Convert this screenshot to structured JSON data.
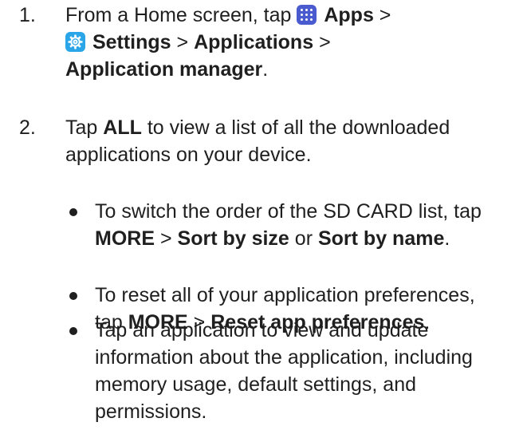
{
  "steps": [
    {
      "number": "1.",
      "line1_prefix": "From a Home screen, tap",
      "apps": "Apps",
      "gt1": ">",
      "settings": "Settings",
      "gt2": ">",
      "applications": "Applications",
      "gt3": ">",
      "app_manager": "Application manager",
      "period": "."
    },
    {
      "number": "2.",
      "prefix": "Tap",
      "all": "ALL",
      "line1_suffix": "to view a list of all the downloaded",
      "line2": "applications on your device."
    }
  ],
  "bullets": [
    {
      "line1": "To switch the order of the SD CARD list, tap",
      "more": "MORE",
      "gt": ">",
      "sort_size": "Sort by size",
      "or": "or",
      "sort_name": "Sort by name",
      "period": "."
    },
    {
      "line1": "To reset all of your application preferences,",
      "tap": "tap",
      "more": "MORE",
      "gt": ">",
      "reset": "Reset app preferences",
      "period": "."
    },
    {
      "line1": "Tap an application to view and update",
      "line2": "information about the application, including",
      "line3": "memory usage, default settings, and",
      "line4": "permissions."
    }
  ],
  "icons": {
    "apps_icon": "apps-grid-icon",
    "settings_icon": "settings-gear-icon",
    "apps_color": "#4a5bd0",
    "settings_color": "#2aa6e8"
  }
}
